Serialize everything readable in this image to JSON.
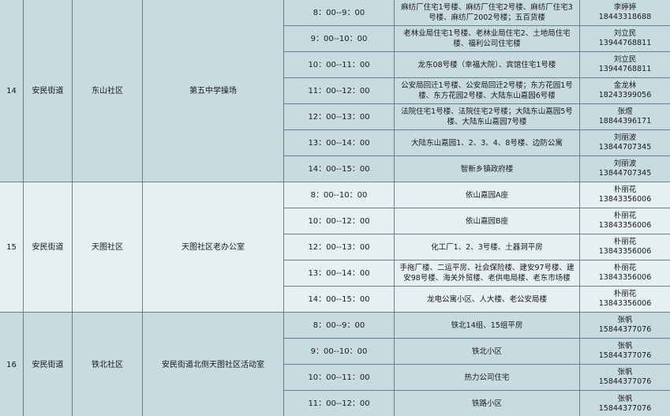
{
  "groups": [
    {
      "no": "14",
      "street": "安民街道",
      "community": "东山社区",
      "site": "第五中学操场",
      "rows": [
        {
          "time": "8：00--9：00",
          "area": "麻纺厂住宅1号楼、麻纺厂住宅2号楼、麻纺厂住宅3号楼、麻纺厂2002号楼；五百货楼",
          "contact": "李婷婷",
          "phone": "18443318688"
        },
        {
          "time": "9：00--10：00",
          "area": "老林业局住宅1号楼、老林业局住宅2、土地局住宅楼、福利公司住宅楼",
          "contact": "刘立民",
          "phone": "13944768811"
        },
        {
          "time": "10：00--11：00",
          "area": "龙东08号楼（幸福大院）、宾馆住宅1号楼",
          "contact": "刘立民",
          "phone": "13944768811"
        },
        {
          "time": "11：00--12：00",
          "area": "公安局回迁1号楼、公安局回迁2号楼；东方花园1号楼、东方花园2号楼、大陆东山嘉园6号楼",
          "contact": "金龙林",
          "phone": "18243399056"
        },
        {
          "time": "12：00--13：00",
          "area": "法院住宅1号楼、法院住宅2号楼；大陆东山嘉园5号楼、大陆东山嘉园7号楼",
          "contact": "张煜",
          "phone": "18844396171"
        },
        {
          "time": "13：00--14：00",
          "area": "大陆东山嘉园1、2、3、4、8号楼、边防公寓",
          "contact": "刘丽波",
          "phone": "13844707345"
        },
        {
          "time": "14：00--15：00",
          "area": "智新乡镇政府楼",
          "contact": "刘丽波",
          "phone": "13844707345"
        }
      ]
    },
    {
      "no": "15",
      "street": "安民街道",
      "community": "天图社区",
      "site": "天图社区老办公室",
      "rows": [
        {
          "time": "8：00--10：00",
          "area": "依山嘉园A座",
          "contact": "朴丽花",
          "phone": "13843356006"
        },
        {
          "time": "10：00--12：00",
          "area": "依山嘉园B座",
          "contact": "朴丽花",
          "phone": "13843356006"
        },
        {
          "time": "12：00--13：00",
          "area": "化工厂1、2、3号楼、土器洞平房",
          "contact": "朴丽花",
          "phone": "13843356006"
        },
        {
          "time": "13：00--14：00",
          "area": "手拖厂楼、二运平房、社会保险楼、建安97号楼、建安98号楼、海关外贸楼、老供电局楼、老东市场楼",
          "contact": "朴丽花",
          "phone": "13843356006"
        },
        {
          "time": "14：00--15：00",
          "area": "龙电公寓小区、人大楼、老公安局楼",
          "contact": "朴丽花",
          "phone": "13843356006"
        }
      ]
    },
    {
      "no": "16",
      "street": "安民街道",
      "community": "铁北社区",
      "site": "安民街道北侧天图社区活动室",
      "rows": [
        {
          "time": "8：00--9：00",
          "area": "铁北14组、15组平房",
          "contact": "张帆",
          "phone": "15844377076"
        },
        {
          "time": "9：00--10：00",
          "area": "铁北小区",
          "contact": "张帆",
          "phone": "15844377076"
        },
        {
          "time": "10：00--11：00",
          "area": "热力公司住宅",
          "contact": "张帆",
          "phone": "15844377076"
        },
        {
          "time": "11：00--12：00",
          "area": "铁路小区",
          "contact": "张帆",
          "phone": "15844377076"
        }
      ]
    }
  ]
}
